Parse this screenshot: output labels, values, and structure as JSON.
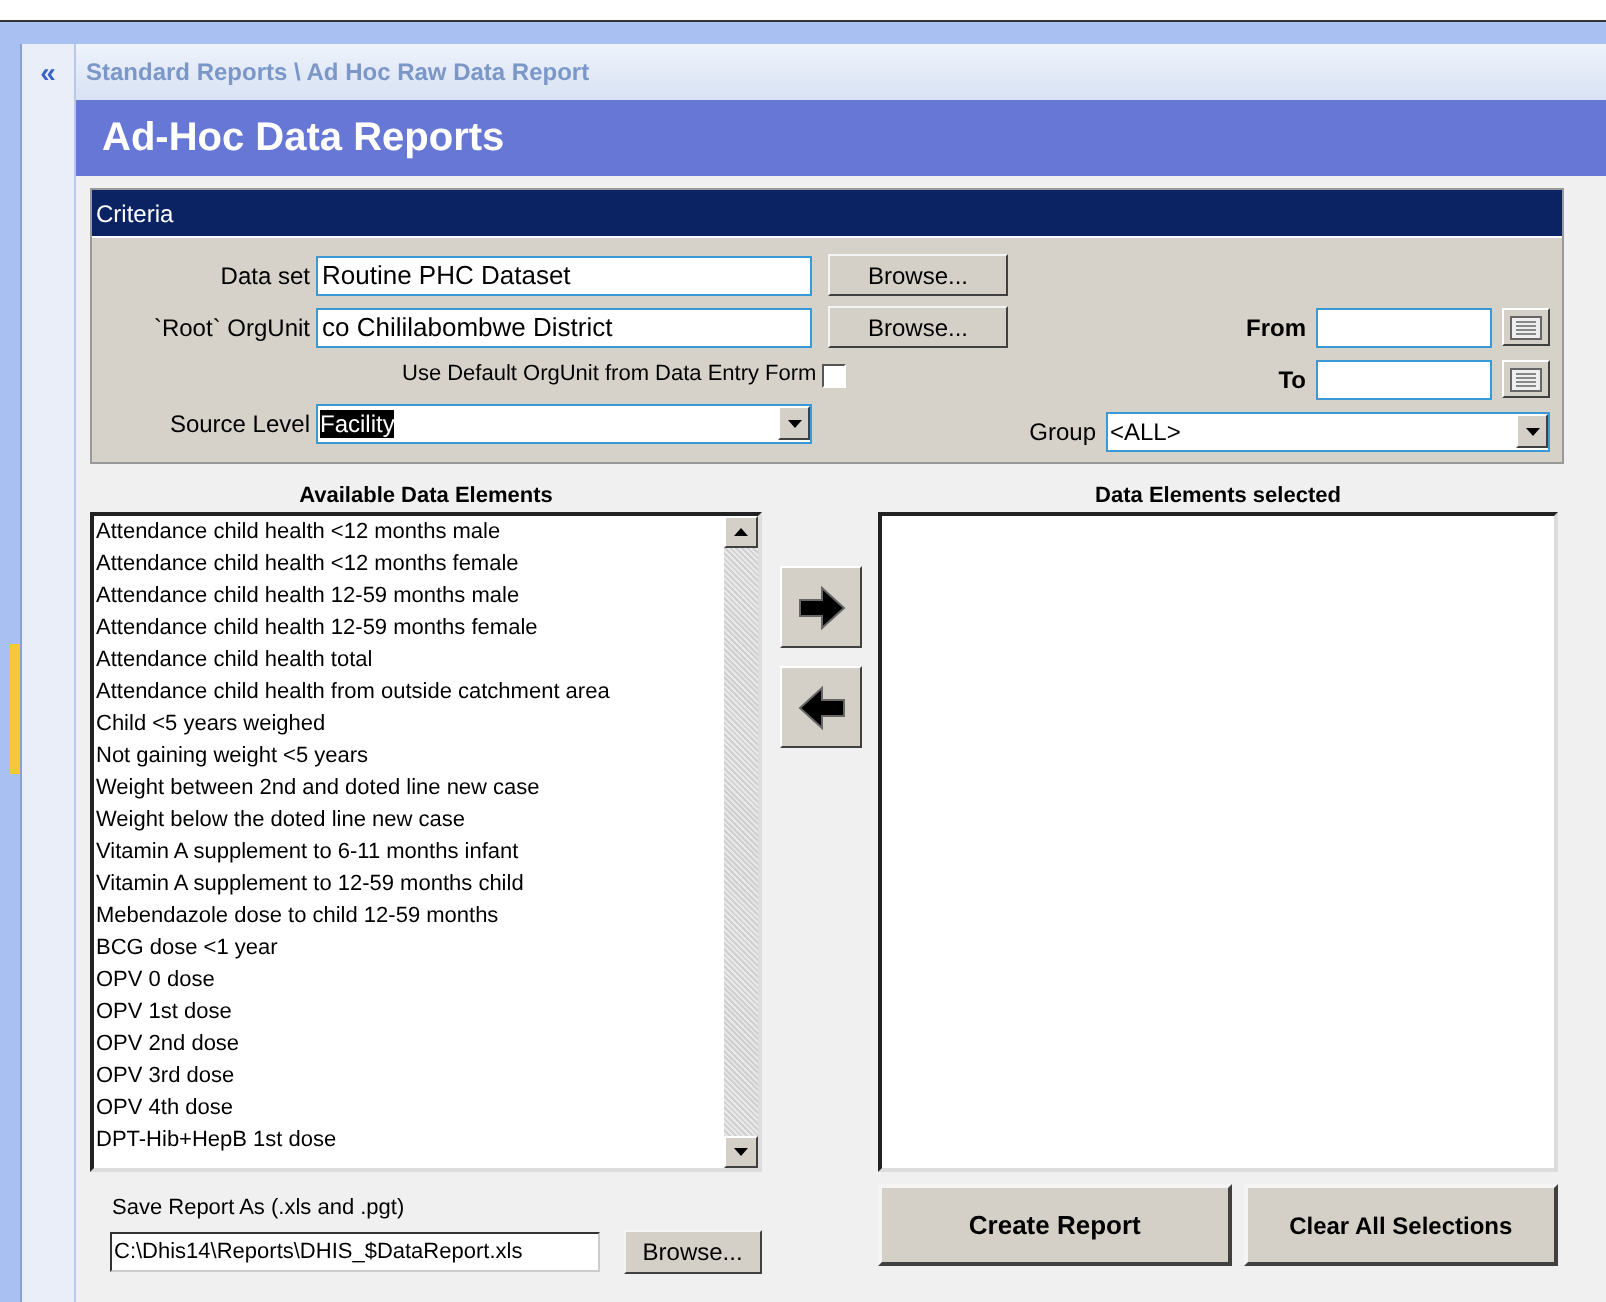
{
  "sidebar": {
    "collapse_glyph": "«"
  },
  "breadcrumb": "Standard Reports \\ Ad Hoc Raw Data Report",
  "title": "Ad-Hoc Data Reports",
  "criteria": {
    "title": "Criteria",
    "data_set": {
      "label": "Data set",
      "value": "Routine PHC Dataset",
      "browse": "Browse..."
    },
    "root_orgunit": {
      "label": "`Root` OrgUnit",
      "value": "co Chililabombwe District",
      "browse": "Browse..."
    },
    "use_default": {
      "label": "Use Default OrgUnit from Data Entry Form",
      "checked": false
    },
    "from": {
      "label": "From"
    },
    "to": {
      "label": "To"
    },
    "source_level": {
      "label": "Source Level",
      "value": "Facility",
      "text_selected": true
    },
    "group": {
      "label": "Group",
      "value": "<ALL>"
    }
  },
  "available": {
    "title": "Available Data Elements",
    "items": [
      "Attendance child health <12 months male",
      "Attendance child health <12 months female",
      "Attendance child health 12-59 months male",
      "Attendance child health 12-59 months female",
      "Attendance child health total",
      "Attendance child health from outside catchment area",
      "Child <5 years weighed",
      "Not gaining weight <5 years",
      "Weight between 2nd and doted line new case",
      "Weight below the doted line new case",
      "Vitamin A supplement to 6-11 months infant",
      "Vitamin A supplement to 12-59 months child",
      "Mebendazole dose to child 12-59 months",
      "BCG dose <1 year",
      "OPV 0 dose",
      "OPV 1st dose",
      "OPV 2nd dose",
      "OPV 3rd dose",
      "OPV 4th dose",
      "DPT-Hib+HepB 1st dose"
    ]
  },
  "selected_list": {
    "title": "Data Elements selected"
  },
  "save": {
    "label": "Save Report As (.xls and .pgt)",
    "value": "C:\\Dhis14\\Reports\\DHIS_$DataReport.xls",
    "browse": "Browse..."
  },
  "actions": [
    "Create Report",
    "Clear All Selections"
  ]
}
